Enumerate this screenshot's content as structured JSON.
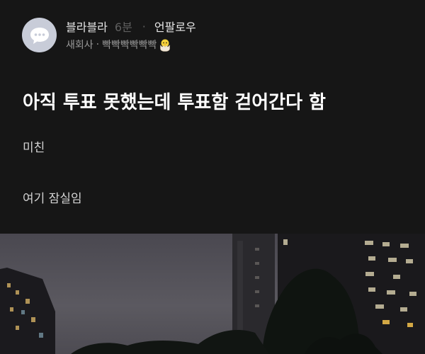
{
  "post": {
    "author": "블라블라",
    "time_ago": "6분",
    "separator": "·",
    "unfollow_label": "언팔로우",
    "company": "새회사",
    "meta_separator": "·",
    "nickname_tag": "빡빡빡빡빡빡",
    "title": "아직 투표 못했는데 투표함 걷어간다 함",
    "body_lines": [
      "미친",
      "여기 잠실임"
    ]
  },
  "colors": {
    "background": "#161616",
    "avatar_bg": "#c8ccd8",
    "muted_text": "#5f5f5f"
  },
  "icons": {
    "avatar": "chat-bubble-icon",
    "badge": "hatching-chick-icon"
  }
}
